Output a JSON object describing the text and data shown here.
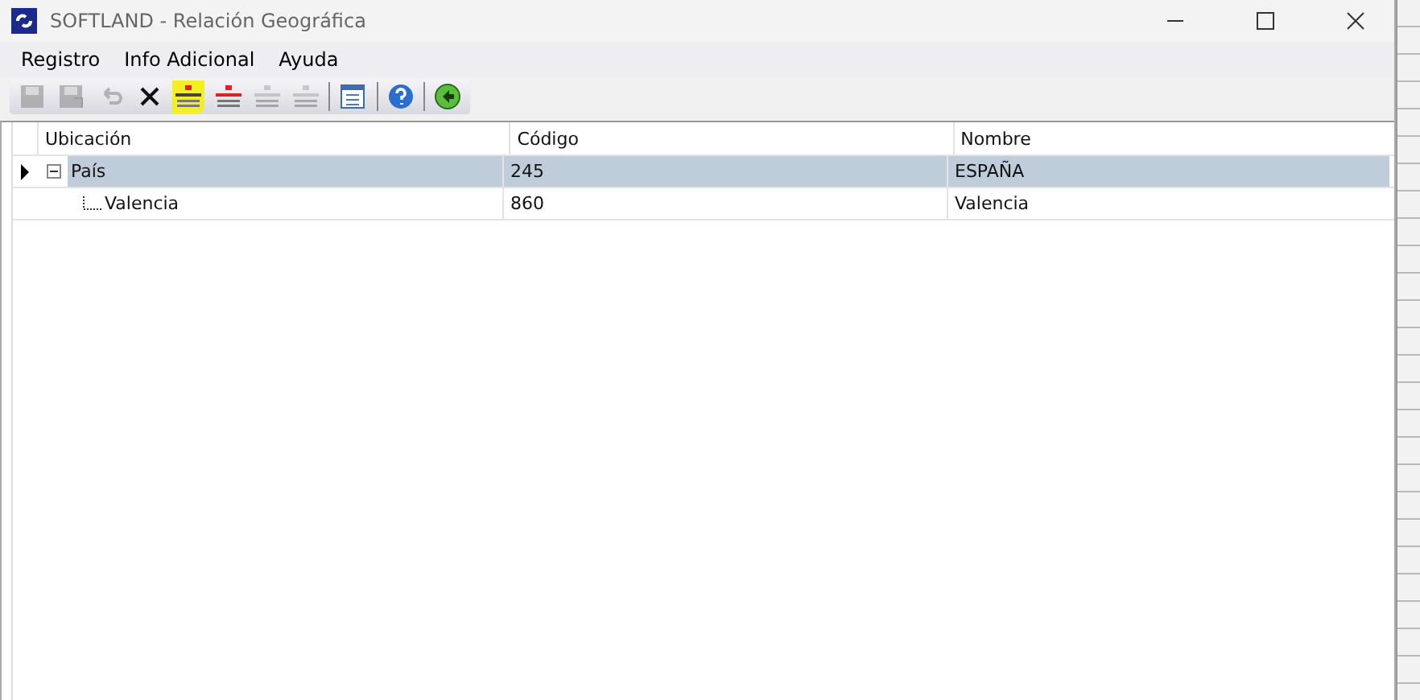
{
  "window": {
    "title": "SOFTLAND - Relación Geográfica"
  },
  "menu": [
    {
      "label": "Registro"
    },
    {
      "label": "Info Adicional"
    },
    {
      "label": "Ayuda"
    }
  ],
  "toolbar": [
    {
      "kind": "save",
      "disabled": true,
      "highlighted": false
    },
    {
      "kind": "save-as",
      "disabled": true,
      "highlighted": false
    },
    {
      "kind": "undo",
      "disabled": true,
      "highlighted": false
    },
    {
      "kind": "delete",
      "disabled": false,
      "highlighted": false
    },
    {
      "kind": "tree-add",
      "disabled": false,
      "highlighted": true
    },
    {
      "kind": "tree-remove",
      "disabled": false,
      "highlighted": false
    },
    {
      "kind": "tree",
      "disabled": true,
      "highlighted": false
    },
    {
      "kind": "tree",
      "disabled": true,
      "highlighted": false
    },
    {
      "kind": "separator"
    },
    {
      "kind": "window",
      "disabled": false,
      "highlighted": false
    },
    {
      "kind": "separator"
    },
    {
      "kind": "help",
      "disabled": false,
      "highlighted": false
    },
    {
      "kind": "separator"
    },
    {
      "kind": "back",
      "disabled": false,
      "highlighted": false
    }
  ],
  "table": {
    "columns": [
      "Ubicación",
      "Código",
      "Nombre"
    ],
    "rows": [
      {
        "cells": [
          "País",
          "245",
          "ESPAÑA"
        ],
        "selected": true,
        "expanded": true,
        "current": true,
        "children": [
          {
            "cells": [
              "Valencia",
              "860",
              "Valencia"
            ],
            "selected": false,
            "current": false
          }
        ]
      }
    ]
  }
}
